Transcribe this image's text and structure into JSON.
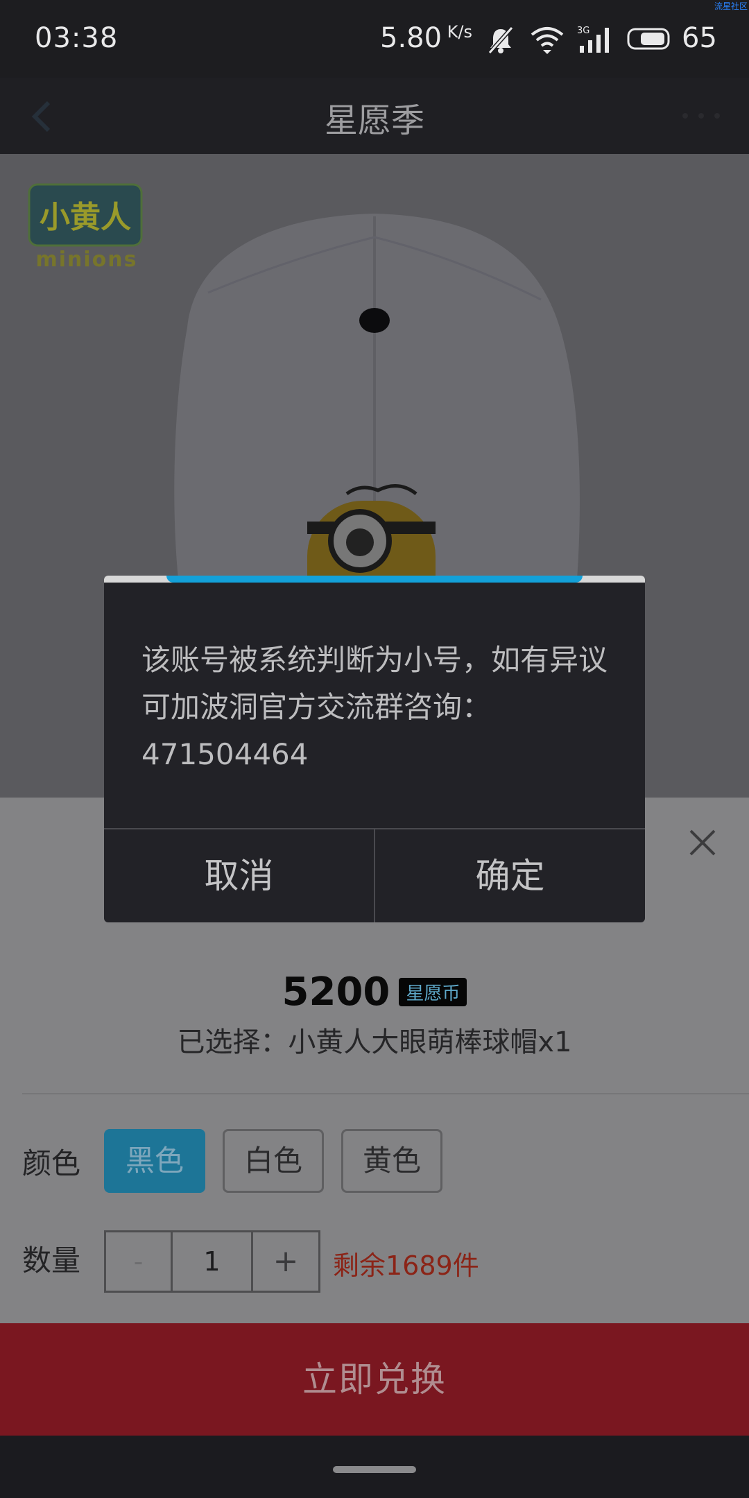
{
  "status_bar": {
    "time": "03:38",
    "speed": "5.80",
    "speed_unit": "K/s",
    "network": "3G",
    "battery": "65",
    "corner_mark": "流星社区"
  },
  "nav": {
    "title": "星愿季"
  },
  "product": {
    "brand_cn": "小黄人",
    "brand_en": "minions"
  },
  "sheet": {
    "price": "5200",
    "currency": "星愿币",
    "selected": "已选择：小黄人大眼萌棒球帽x1",
    "color_label": "颜色",
    "colors": [
      "黑色",
      "白色",
      "黄色"
    ],
    "selected_color": "黑色",
    "quantity_label": "数量",
    "decrement": "-",
    "quantity": "1",
    "increment": "+",
    "stock": "剩余1689件"
  },
  "cta": {
    "label": "立即兑换"
  },
  "dialog": {
    "message": "该账号被系统判断为小号，如有异议可加波洞官方交流群咨询：471504464",
    "cancel": "取消",
    "confirm": "确定"
  }
}
